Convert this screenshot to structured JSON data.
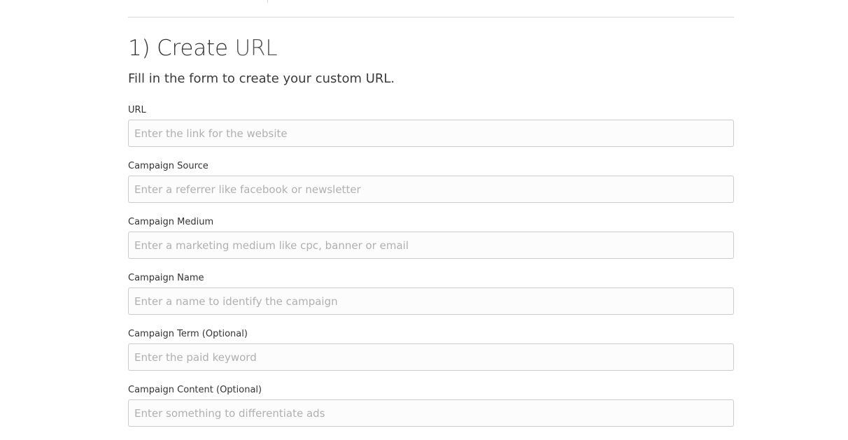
{
  "section": {
    "heading_prefix": "1) Create",
    "heading_emphasis": "URL",
    "intro": "Fill in the form to create your custom URL."
  },
  "fields": [
    {
      "label": "URL",
      "placeholder": "Enter the link for the website",
      "value": ""
    },
    {
      "label": "Campaign Source",
      "placeholder": "Enter a referrer like facebook or newsletter",
      "value": ""
    },
    {
      "label": "Campaign Medium",
      "placeholder": "Enter a marketing medium like cpc, banner or email",
      "value": ""
    },
    {
      "label": "Campaign Name",
      "placeholder": "Enter a name to identify the campaign",
      "value": ""
    },
    {
      "label": "Campaign Term (Optional)",
      "placeholder": "Enter the paid keyword",
      "value": ""
    },
    {
      "label": "Campaign Content (Optional)",
      "placeholder": "Enter something to differentiate ads",
      "value": ""
    }
  ]
}
